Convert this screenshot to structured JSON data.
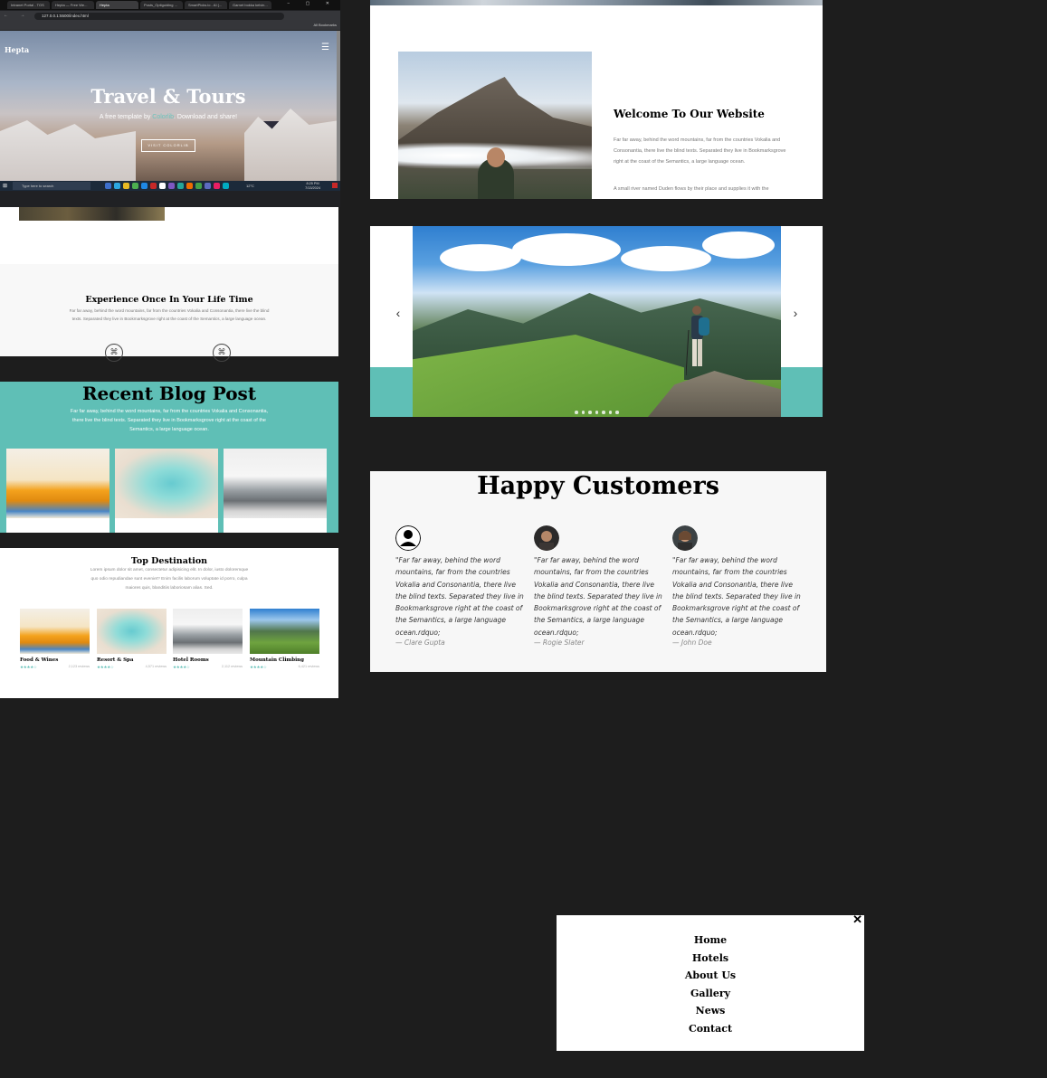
{
  "browser": {
    "tabs": [
      "Intranet Portal - TOS",
      "Hepta — Free We...",
      "Hepta",
      "Posts_Optiguiding ...",
      "SmartPicks.io - AI (...",
      "Garnet bokka kelvin..."
    ],
    "active_tab_index": 2,
    "address": "127.0.0.1:5500/index.html",
    "bookmarks_label": "All Bookmarks",
    "taskbar_search": "Type here to search",
    "weather": "12°C",
    "time": "8:25 PM",
    "date": "7/13/2024"
  },
  "hero": {
    "logo": "Hepta",
    "title": "Travel & Tours",
    "subtitle_pre": "A free template by",
    "subtitle_link": "Colorlib",
    "subtitle_post": ". Download and share!",
    "button": "VISIT COLORLIB"
  },
  "experience": {
    "heading": "Experience Once In Your Life Time",
    "text": "Far far away, behind the word mountains, far from the countries Vokalia and Consonantia, there live the blind texts. Separated they live in Bookmarksgrove right at the coast of the Semantics, a large language ocean."
  },
  "blog": {
    "heading": "Recent Blog Post",
    "text": "Far far away, behind the word mountains, far from the countries Vokalia and Consonantia, there live the blind texts. Separated they live in Bookmarksgrove right at the coast of the Semantics, a large language ocean."
  },
  "destination": {
    "heading": "Top Destination",
    "text": "Lorem ipsum dolor sit amet, consectetur adipisicing elit. In dolor, iusto doloremque quo odio repudiandae sunt eveniet? Enim facilis laborum voluptate id porro, culpa maiores quis, blanditiis laboriosam alias. Sed.",
    "items": [
      {
        "title": "Food & Wines",
        "stars": "★★★★☆",
        "reviews": "2,123 reviews"
      },
      {
        "title": "Resort & Spa",
        "stars": "★★★★☆",
        "reviews": "4,571 reviews"
      },
      {
        "title": "Hotel Rooms",
        "stars": "★★★★☆",
        "reviews": "2,112 reviews"
      },
      {
        "title": "Mountain Climbing",
        "stars": "★★★★☆",
        "reviews": "6,421 reviews"
      }
    ]
  },
  "welcome": {
    "heading": "Welcome To Our Website",
    "text1": "Far far away, behind the word mountains, far from the countries Vokalia and Consonantia, there live the blind texts. Separated they live in Bookmarksgrove right at the coast of the Semantics, a large language ocean.",
    "text2": "A small river named Duden flows by their place and supplies it with the"
  },
  "carousel": {
    "prev_icon": "chevron-left-icon",
    "next_icon": "chevron-right-icon",
    "prev": "‹",
    "next": "›"
  },
  "customers": {
    "heading": "Happy Customers",
    "items": [
      {
        "quote": "\"Far far away, behind the word mountains, far from the countries Vokalia and Consonantia, there live the blind texts. Separated they live in Bookmarksgrove right at the coast of the Semantics, a large language ocean.rdquo;",
        "name": "— Clare Gupta"
      },
      {
        "quote": "\"Far far away, behind the word mountains, far from the countries Vokalia and Consonantia, there live the blind texts. Separated they live in Bookmarksgrove right at the coast of the Semantics, a large language ocean.rdquo;",
        "name": "— Rogie Slater"
      },
      {
        "quote": "\"Far far away, behind the word mountains, far from the countries Vokalia and Consonantia, there live the blind texts. Separated they live in Bookmarksgrove right at the coast of the Semantics, a large language ocean.rdquo;",
        "name": "— John Doe"
      }
    ]
  },
  "menu": {
    "close": "✕",
    "items": [
      "Home",
      "Hotels",
      "About Us",
      "Gallery",
      "News",
      "Contact"
    ]
  },
  "colors": {
    "accent": "#5fbfb6",
    "background": "#1d1d1d"
  }
}
